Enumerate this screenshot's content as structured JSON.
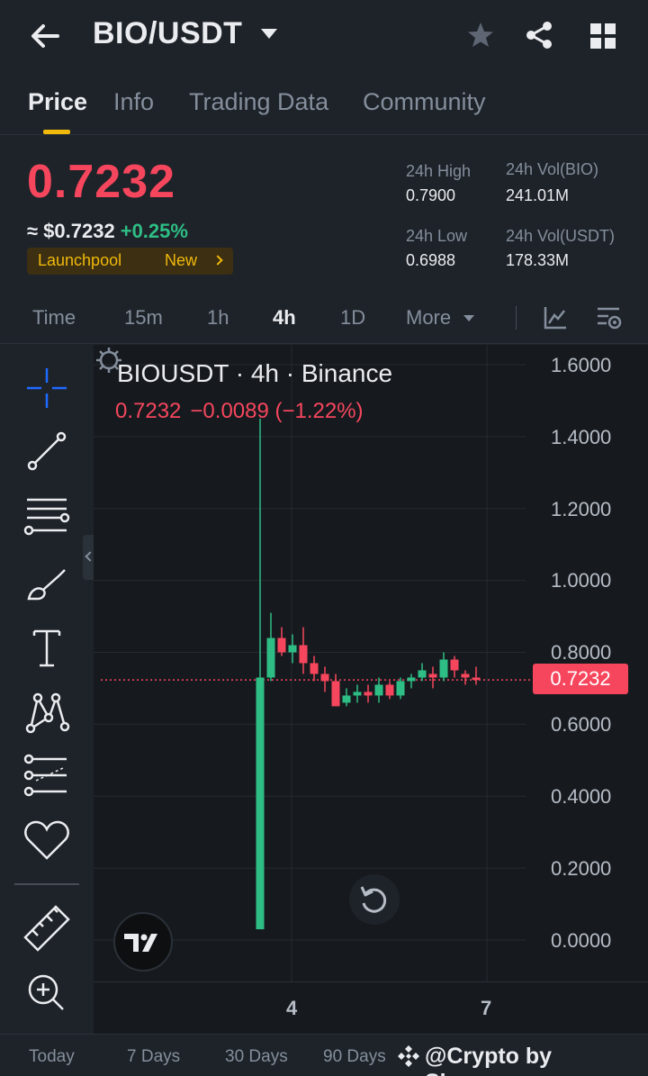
{
  "header": {
    "pair": "BIO/USDT",
    "icons": [
      "back-arrow-icon",
      "star-icon",
      "share-icon",
      "grid-icon"
    ]
  },
  "tabs": [
    {
      "label": "Price",
      "active": true
    },
    {
      "label": "Info"
    },
    {
      "label": "Trading Data"
    },
    {
      "label": "Community"
    }
  ],
  "price": {
    "last": "0.7232",
    "usd_prefix": "≈ $0.7232",
    "change": "+0.25%",
    "badge_label": "Launchpool",
    "badge_tag": "New"
  },
  "stats": {
    "high_label": "24h High",
    "high": "0.7900",
    "low_label": "24h Low",
    "low": "0.6988",
    "vol_base_label": "24h Vol(BIO)",
    "vol_base": "241.01M",
    "vol_quote_label": "24h Vol(USDT)",
    "vol_quote": "178.33M"
  },
  "intervals": [
    "Time",
    "15m",
    "1h",
    "4h",
    "1D",
    "More"
  ],
  "active_interval": "4h",
  "chart": {
    "title": "BIOUSDT · 4h · Binance",
    "ohlc_last": "0.7232",
    "ohlc_change": "−0.0089 (−1.22%)",
    "price_tag": "0.7232",
    "y_labels": [
      "1.6000",
      "1.4000",
      "1.2000",
      "1.0000",
      "0.8000",
      "0.6000",
      "0.4000",
      "0.2000",
      "0.0000"
    ],
    "x_labels": [
      "4",
      "7"
    ]
  },
  "chart_data": {
    "type": "candlestick",
    "title": "BIOUSDT · 4h · Binance",
    "ylim": [
      0,
      1.6
    ],
    "y_ticks": [
      1.6,
      1.4,
      1.2,
      1.0,
      0.8,
      0.6,
      0.4,
      0.2,
      0.0
    ],
    "x_ticks": [
      "4",
      "7"
    ],
    "last_price": 0.7232,
    "grid": true,
    "colors": {
      "up": "#2ebd85",
      "down": "#f6465d"
    },
    "candles": [
      {
        "o": 0.03,
        "h": 1.45,
        "l": 0.03,
        "c": 0.73
      },
      {
        "o": 0.73,
        "h": 0.91,
        "l": 0.72,
        "c": 0.84
      },
      {
        "o": 0.84,
        "h": 0.87,
        "l": 0.79,
        "c": 0.8
      },
      {
        "o": 0.8,
        "h": 0.85,
        "l": 0.77,
        "c": 0.82
      },
      {
        "o": 0.82,
        "h": 0.87,
        "l": 0.74,
        "c": 0.77
      },
      {
        "o": 0.77,
        "h": 0.79,
        "l": 0.72,
        "c": 0.74
      },
      {
        "o": 0.74,
        "h": 0.76,
        "l": 0.69,
        "c": 0.72
      },
      {
        "o": 0.72,
        "h": 0.74,
        "l": 0.66,
        "c": 0.65
      },
      {
        "o": 0.66,
        "h": 0.7,
        "l": 0.65,
        "c": 0.68
      },
      {
        "o": 0.68,
        "h": 0.71,
        "l": 0.66,
        "c": 0.69
      },
      {
        "o": 0.69,
        "h": 0.71,
        "l": 0.66,
        "c": 0.68
      },
      {
        "o": 0.68,
        "h": 0.73,
        "l": 0.66,
        "c": 0.71
      },
      {
        "o": 0.71,
        "h": 0.72,
        "l": 0.67,
        "c": 0.68
      },
      {
        "o": 0.68,
        "h": 0.73,
        "l": 0.67,
        "c": 0.72
      },
      {
        "o": 0.72,
        "h": 0.74,
        "l": 0.7,
        "c": 0.73
      },
      {
        "o": 0.73,
        "h": 0.77,
        "l": 0.72,
        "c": 0.75
      },
      {
        "o": 0.74,
        "h": 0.76,
        "l": 0.7,
        "c": 0.73
      },
      {
        "o": 0.73,
        "h": 0.8,
        "l": 0.72,
        "c": 0.78
      },
      {
        "o": 0.78,
        "h": 0.79,
        "l": 0.73,
        "c": 0.75
      },
      {
        "o": 0.74,
        "h": 0.75,
        "l": 0.71,
        "c": 0.73
      },
      {
        "o": 0.73,
        "h": 0.76,
        "l": 0.71,
        "c": 0.7232
      }
    ]
  },
  "ranges": [
    "Today",
    "7 Days",
    "30 Days",
    "90 Days"
  ],
  "watermark": "@Crypto by Shameer",
  "accent": "#f0b90b"
}
